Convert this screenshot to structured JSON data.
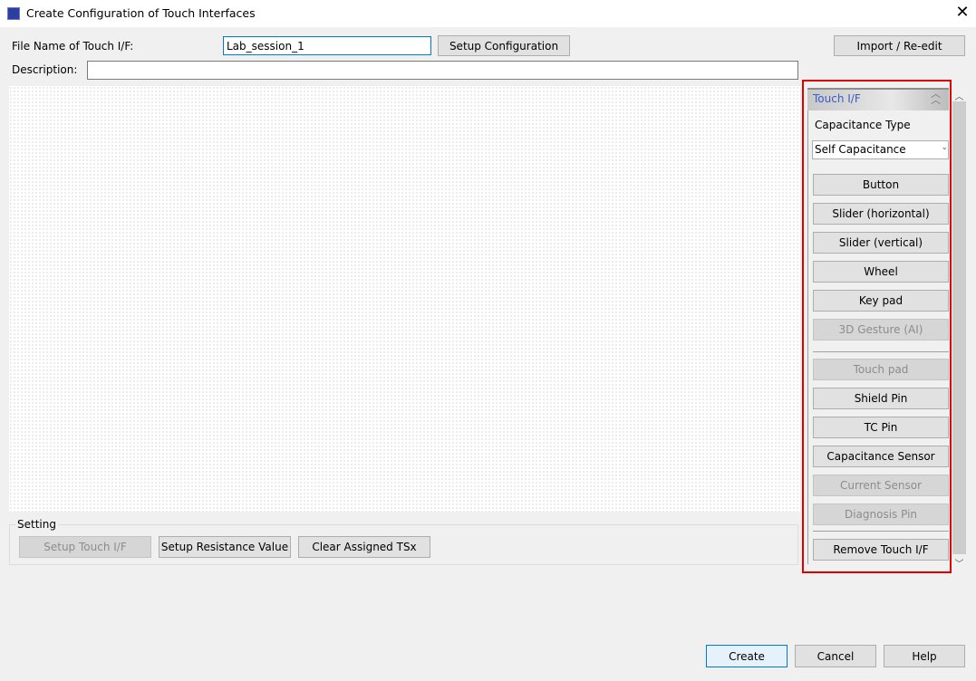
{
  "window": {
    "title": "Create Configuration of Touch Interfaces",
    "close": "✕"
  },
  "form": {
    "file_name_label": "File Name of Touch I/F:",
    "file_name_value": "Lab_session_1",
    "setup_configuration": "Setup Configuration",
    "import_reedit": "Import / Re-edit",
    "description_label": "Description:",
    "description_value": ""
  },
  "setting": {
    "label": "Setting",
    "setup_touch_if": "Setup Touch I/F",
    "setup_resistance": "Setup Resistance Value",
    "clear_assigned": "Clear Assigned TSx"
  },
  "panel": {
    "header": "Touch I/F",
    "collapse_icon": "double-chevron-up",
    "capacitance_label": "Capacitance Type",
    "capacitance_value": "Self Capacitance",
    "buttons": [
      "Button",
      "Slider (horizontal)",
      "Slider (vertical)",
      "Wheel",
      "Key pad",
      "3D Gesture (AI)",
      "Touch pad",
      "Shield Pin",
      "TC Pin",
      "Capacitance Sensor",
      "Current Sensor",
      "Diagnosis Pin",
      "Remove Touch I/F"
    ],
    "disabled": [
      "3D Gesture (AI)",
      "Touch pad",
      "Current Sensor",
      "Diagnosis Pin"
    ],
    "highlight_color": "#e00000",
    "header_text_color": "#3b5bc4"
  },
  "footer": {
    "create": "Create",
    "cancel": "Cancel",
    "help": "Help"
  }
}
